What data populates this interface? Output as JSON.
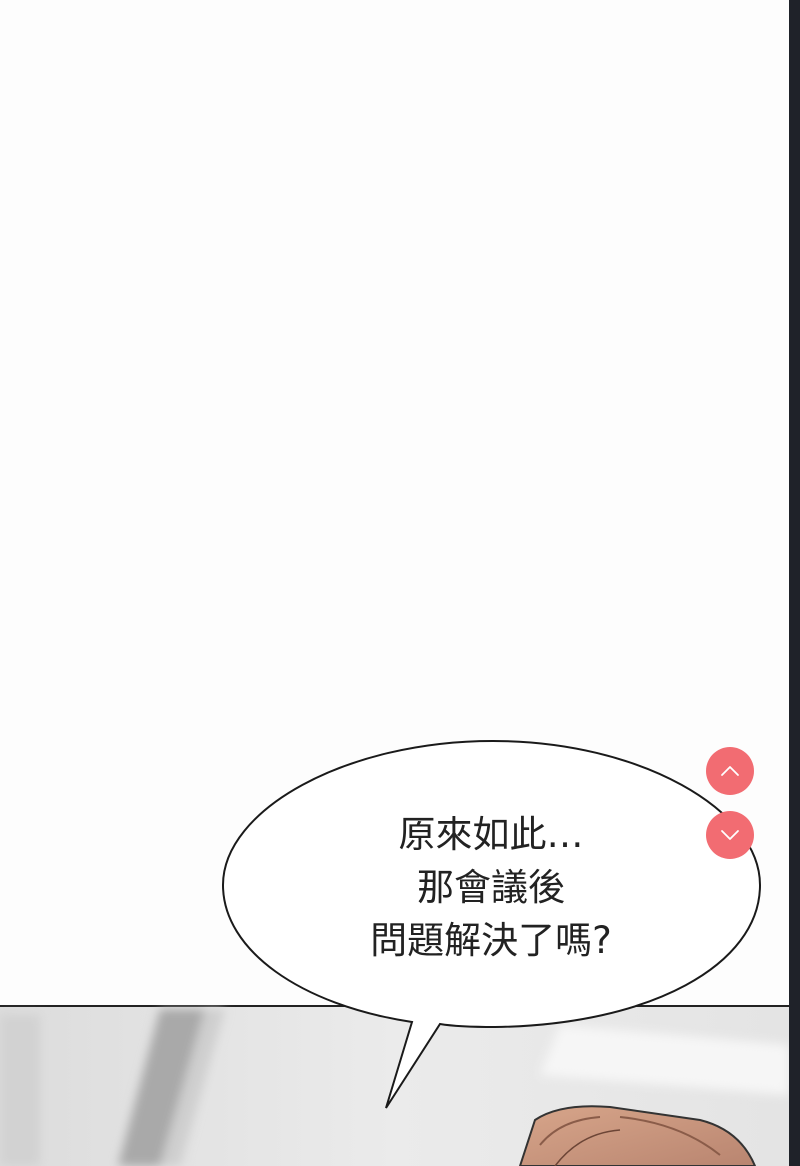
{
  "speech_bubble": {
    "lines": [
      "原來如此…",
      "那會議後",
      "問題解決了嗎?"
    ]
  },
  "nav": {
    "up_icon": "chevron-up-icon",
    "down_icon": "chevron-down-icon",
    "button_color": "#f26c72"
  },
  "colors": {
    "page_background": "#fdfdfd",
    "scrollbar_track": "#1f2229"
  }
}
